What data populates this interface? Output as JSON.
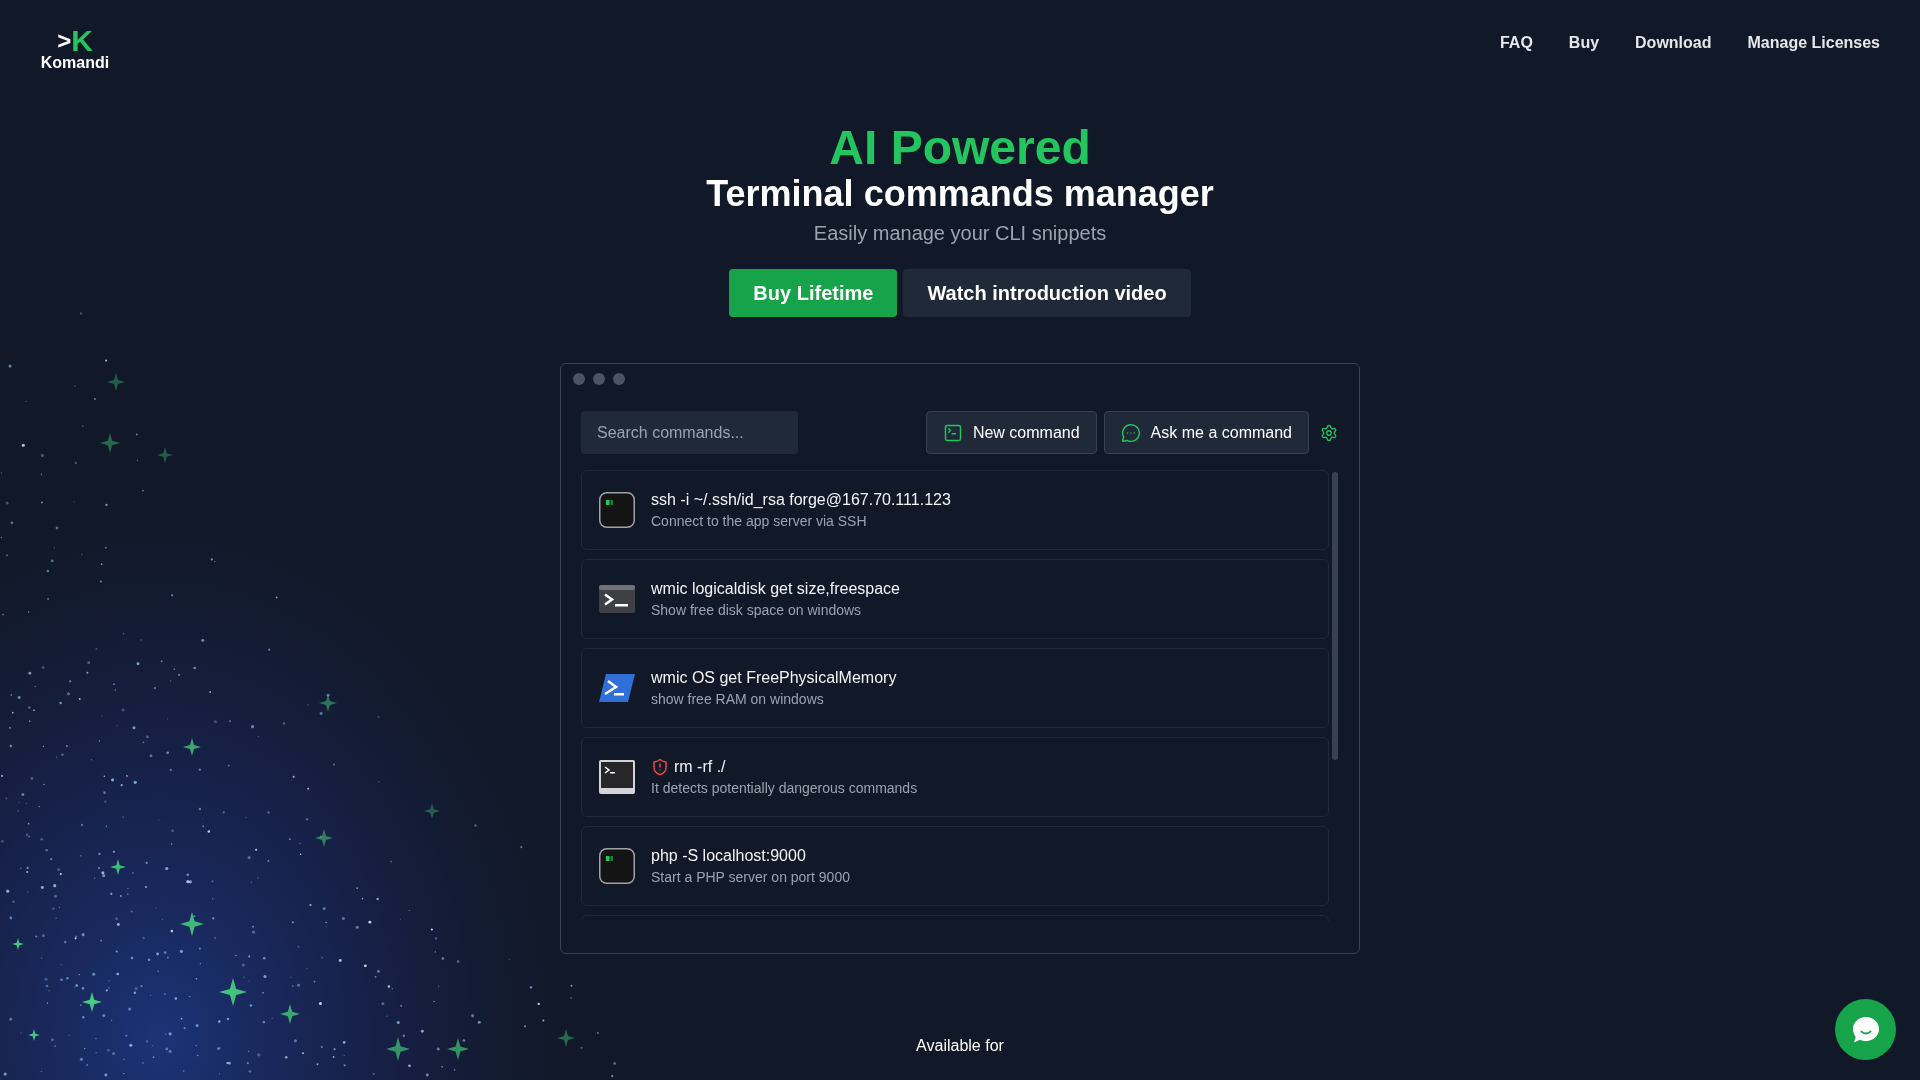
{
  "logo": {
    "prompt": ">",
    "letter": "K",
    "name": "Komandi"
  },
  "nav": [
    {
      "label": "FAQ"
    },
    {
      "label": "Buy"
    },
    {
      "label": "Download"
    },
    {
      "label": "Manage Licenses"
    }
  ],
  "hero": {
    "headline": "AI Powered",
    "title": "Terminal commands manager",
    "subtitle": "Easily manage your CLI snippets",
    "buttons": [
      {
        "label": "Buy Lifetime",
        "kind": "primary"
      },
      {
        "label": "Watch introduction video",
        "kind": "secondary"
      }
    ]
  },
  "app_window": {
    "search": {
      "placeholder": "Search commands..."
    },
    "actions": [
      {
        "label": "New command",
        "kind": "new"
      },
      {
        "label": "Ask me a command",
        "kind": "ask"
      }
    ],
    "commands": [
      {
        "command": "ssh -i ~/.ssh/id_rsa forge@167.70.111.123",
        "description": "Connect to the app server via SSH",
        "kind": "terminal",
        "dangerous": false
      },
      {
        "command": "wmic logicaldisk get size,freespace",
        "description": "Show free disk space on windows",
        "kind": "console",
        "dangerous": false
      },
      {
        "command": "wmic OS get FreePhysicalMemory",
        "description": "show free RAM on windows",
        "kind": "shell",
        "dangerous": false
      },
      {
        "command": "rm -rf ./",
        "description": "It detects potentially dangerous commands",
        "kind": "window",
        "dangerous": true
      },
      {
        "command": "php -S localhost:9000",
        "description": "Start a PHP server on port 9000",
        "kind": "terminal",
        "dangerous": false
      }
    ]
  },
  "footer": {
    "available_label": "Available for"
  }
}
